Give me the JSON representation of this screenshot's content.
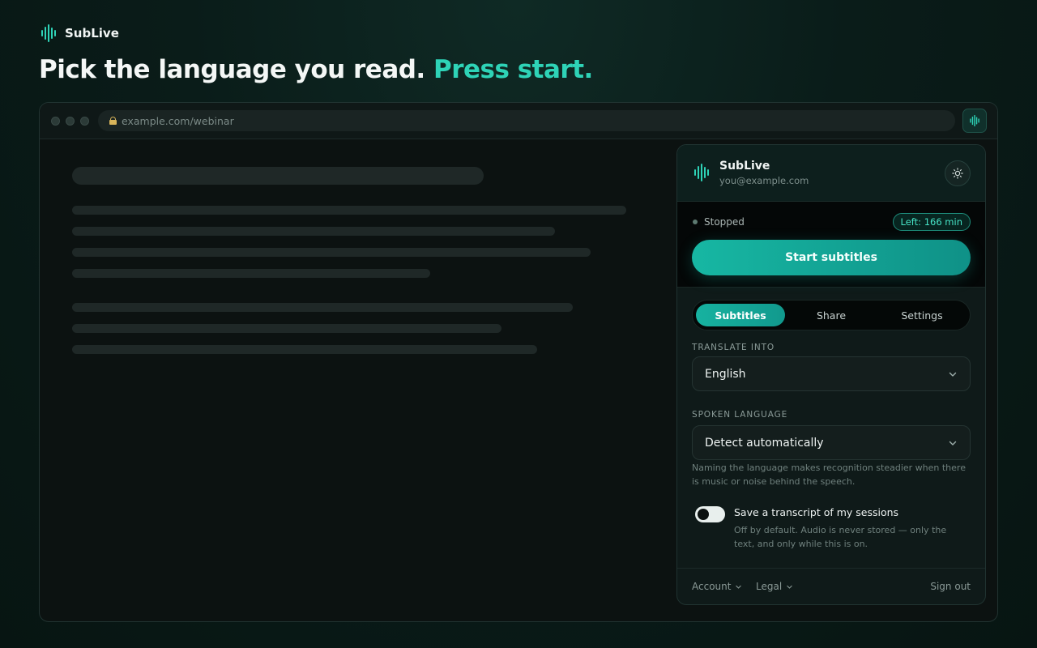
{
  "brand": {
    "name": "SubLive"
  },
  "headline": {
    "main": "Pick the language you read.",
    "accent": "Press start."
  },
  "browser": {
    "url": "example.com/webinar"
  },
  "panel": {
    "title": "SubLive",
    "email": "you@example.com",
    "status": "Stopped",
    "time_left": "Left: 166 min",
    "start_label": "Start subtitles",
    "tabs": [
      {
        "label": "Subtitles",
        "active": true
      },
      {
        "label": "Share",
        "active": false
      },
      {
        "label": "Settings",
        "active": false
      }
    ],
    "translate_label": "TRANSLATE INTO",
    "translate_value": "English",
    "spoken_label": "SPOKEN LANGUAGE",
    "spoken_value": "Detect automatically",
    "spoken_hint": "Naming the language makes recognition steadier when there is music or noise behind the speech.",
    "transcript_title": "Save a transcript of my sessions",
    "transcript_desc": "Off by default. Audio is never stored — only the text, and only while this is on.",
    "transcript_enabled": false,
    "footer": {
      "account": "Account",
      "legal": "Legal",
      "signout": "Sign out"
    }
  },
  "colors": {
    "accent": "#2ed3b7",
    "button": "#17b7a3",
    "background": "#0a1c19"
  },
  "icons": {
    "logo": "waveform-icon",
    "settings": "sun-icon",
    "lock": "lock-icon",
    "chevron": "chevron-down-icon"
  }
}
